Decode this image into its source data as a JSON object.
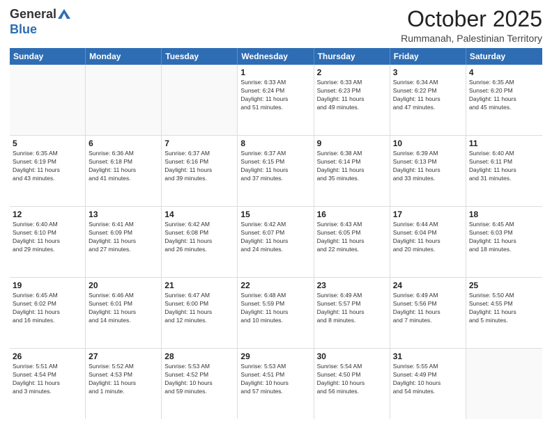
{
  "header": {
    "logo_general": "General",
    "logo_blue": "Blue",
    "month_title": "October 2025",
    "location": "Rummanah, Palestinian Territory"
  },
  "weekdays": [
    "Sunday",
    "Monday",
    "Tuesday",
    "Wednesday",
    "Thursday",
    "Friday",
    "Saturday"
  ],
  "rows": [
    [
      {
        "day": "",
        "info": ""
      },
      {
        "day": "",
        "info": ""
      },
      {
        "day": "",
        "info": ""
      },
      {
        "day": "1",
        "info": "Sunrise: 6:33 AM\nSunset: 6:24 PM\nDaylight: 11 hours\nand 51 minutes."
      },
      {
        "day": "2",
        "info": "Sunrise: 6:33 AM\nSunset: 6:23 PM\nDaylight: 11 hours\nand 49 minutes."
      },
      {
        "day": "3",
        "info": "Sunrise: 6:34 AM\nSunset: 6:22 PM\nDaylight: 11 hours\nand 47 minutes."
      },
      {
        "day": "4",
        "info": "Sunrise: 6:35 AM\nSunset: 6:20 PM\nDaylight: 11 hours\nand 45 minutes."
      }
    ],
    [
      {
        "day": "5",
        "info": "Sunrise: 6:35 AM\nSunset: 6:19 PM\nDaylight: 11 hours\nand 43 minutes."
      },
      {
        "day": "6",
        "info": "Sunrise: 6:36 AM\nSunset: 6:18 PM\nDaylight: 11 hours\nand 41 minutes."
      },
      {
        "day": "7",
        "info": "Sunrise: 6:37 AM\nSunset: 6:16 PM\nDaylight: 11 hours\nand 39 minutes."
      },
      {
        "day": "8",
        "info": "Sunrise: 6:37 AM\nSunset: 6:15 PM\nDaylight: 11 hours\nand 37 minutes."
      },
      {
        "day": "9",
        "info": "Sunrise: 6:38 AM\nSunset: 6:14 PM\nDaylight: 11 hours\nand 35 minutes."
      },
      {
        "day": "10",
        "info": "Sunrise: 6:39 AM\nSunset: 6:13 PM\nDaylight: 11 hours\nand 33 minutes."
      },
      {
        "day": "11",
        "info": "Sunrise: 6:40 AM\nSunset: 6:11 PM\nDaylight: 11 hours\nand 31 minutes."
      }
    ],
    [
      {
        "day": "12",
        "info": "Sunrise: 6:40 AM\nSunset: 6:10 PM\nDaylight: 11 hours\nand 29 minutes."
      },
      {
        "day": "13",
        "info": "Sunrise: 6:41 AM\nSunset: 6:09 PM\nDaylight: 11 hours\nand 27 minutes."
      },
      {
        "day": "14",
        "info": "Sunrise: 6:42 AM\nSunset: 6:08 PM\nDaylight: 11 hours\nand 26 minutes."
      },
      {
        "day": "15",
        "info": "Sunrise: 6:42 AM\nSunset: 6:07 PM\nDaylight: 11 hours\nand 24 minutes."
      },
      {
        "day": "16",
        "info": "Sunrise: 6:43 AM\nSunset: 6:05 PM\nDaylight: 11 hours\nand 22 minutes."
      },
      {
        "day": "17",
        "info": "Sunrise: 6:44 AM\nSunset: 6:04 PM\nDaylight: 11 hours\nand 20 minutes."
      },
      {
        "day": "18",
        "info": "Sunrise: 6:45 AM\nSunset: 6:03 PM\nDaylight: 11 hours\nand 18 minutes."
      }
    ],
    [
      {
        "day": "19",
        "info": "Sunrise: 6:45 AM\nSunset: 6:02 PM\nDaylight: 11 hours\nand 16 minutes."
      },
      {
        "day": "20",
        "info": "Sunrise: 6:46 AM\nSunset: 6:01 PM\nDaylight: 11 hours\nand 14 minutes."
      },
      {
        "day": "21",
        "info": "Sunrise: 6:47 AM\nSunset: 6:00 PM\nDaylight: 11 hours\nand 12 minutes."
      },
      {
        "day": "22",
        "info": "Sunrise: 6:48 AM\nSunset: 5:59 PM\nDaylight: 11 hours\nand 10 minutes."
      },
      {
        "day": "23",
        "info": "Sunrise: 6:49 AM\nSunset: 5:57 PM\nDaylight: 11 hours\nand 8 minutes."
      },
      {
        "day": "24",
        "info": "Sunrise: 6:49 AM\nSunset: 5:56 PM\nDaylight: 11 hours\nand 7 minutes."
      },
      {
        "day": "25",
        "info": "Sunrise: 5:50 AM\nSunset: 4:55 PM\nDaylight: 11 hours\nand 5 minutes."
      }
    ],
    [
      {
        "day": "26",
        "info": "Sunrise: 5:51 AM\nSunset: 4:54 PM\nDaylight: 11 hours\nand 3 minutes."
      },
      {
        "day": "27",
        "info": "Sunrise: 5:52 AM\nSunset: 4:53 PM\nDaylight: 11 hours\nand 1 minute."
      },
      {
        "day": "28",
        "info": "Sunrise: 5:53 AM\nSunset: 4:52 PM\nDaylight: 10 hours\nand 59 minutes."
      },
      {
        "day": "29",
        "info": "Sunrise: 5:53 AM\nSunset: 4:51 PM\nDaylight: 10 hours\nand 57 minutes."
      },
      {
        "day": "30",
        "info": "Sunrise: 5:54 AM\nSunset: 4:50 PM\nDaylight: 10 hours\nand 56 minutes."
      },
      {
        "day": "31",
        "info": "Sunrise: 5:55 AM\nSunset: 4:49 PM\nDaylight: 10 hours\nand 54 minutes."
      },
      {
        "day": "",
        "info": ""
      }
    ]
  ]
}
